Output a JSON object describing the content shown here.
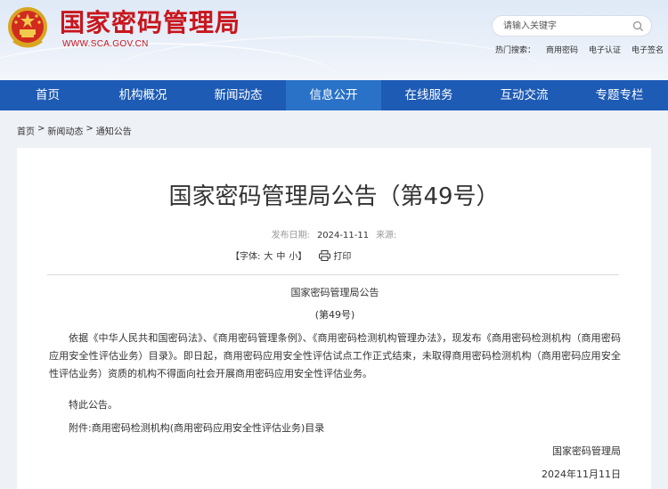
{
  "header": {
    "site_name": "国家密码管理局",
    "site_url": "WWW.SCA.GOV.CN",
    "search_placeholder": "请输入关键字",
    "hot_label": "热门搜索：",
    "hot_items": [
      "商用密码",
      "电子认证",
      "电子签名"
    ]
  },
  "nav": {
    "items": [
      "首页",
      "机构概况",
      "新闻动态",
      "信息公开",
      "在线服务",
      "互动交流",
      "专题专栏"
    ],
    "active_index": 3
  },
  "breadcrumb": {
    "items": [
      "首页",
      "新闻动态",
      "通知公告"
    ],
    "separator": ">"
  },
  "article": {
    "title": "国家密码管理局公告（第49号）",
    "date_label": "发布日期:",
    "date": "2024-11-11",
    "source_label": "来源:",
    "font_label": "【字体:",
    "font_sizes": [
      "大",
      "中",
      "小"
    ],
    "font_close": "】",
    "print_label": "打印",
    "heading": "国家密码管理局公告",
    "number": "(第49号)",
    "paragraph": "依据《中华人民共和国密码法》、《商用密码管理条例》、《商用密码检测机构管理办法》，现发布《商用密码检测机构（商用密码应用安全性评估业务）目录》。即日起，商用密码应用安全性评估试点工作正式结束，未取得商用密码检测机构（商用密码应用安全性评估业务）资质的机构不得面向社会开展商用密码应用安全性评估业务。",
    "closing": "特此公告。",
    "attachment": "附件:商用密码检测机构(商用密码应用安全性评估业务)目录",
    "signature": "国家密码管理局",
    "sign_date": "2024年11月11日"
  },
  "colors": {
    "brand_red": "#c8161d",
    "nav_blue": "#1d5bb5",
    "nav_active": "#2a72c8"
  }
}
